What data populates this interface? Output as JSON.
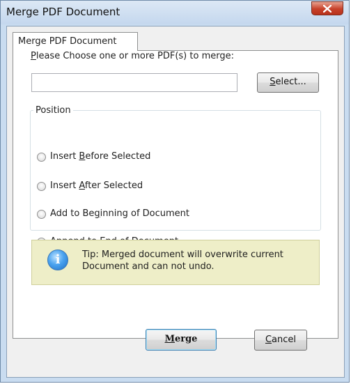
{
  "window": {
    "title": "Merge PDF Document"
  },
  "tab": {
    "label": "Merge PDF Document"
  },
  "instruction": {
    "prefix": "P",
    "rest": "lease Choose one or more PDF(s) to merge:"
  },
  "file_input": {
    "value": "",
    "placeholder": ""
  },
  "select_button": {
    "prefix": "S",
    "rest": "elect..."
  },
  "position_group": {
    "label": "Position",
    "options": [
      {
        "pre": "Insert ",
        "key": "B",
        "post": "efore Selected",
        "checked": false
      },
      {
        "pre": "Insert ",
        "key": "A",
        "post": "fter Selected",
        "checked": false
      },
      {
        "pre": "Add to Be",
        "key": "g",
        "post": "inning of Document",
        "checked": false
      },
      {
        "pre": "Append to ",
        "key": "E",
        "post": "nd of Document",
        "checked": true
      }
    ]
  },
  "tip": {
    "icon": "info-icon",
    "line1": "Tip: Merged document will overwrite current",
    "line2": "Document and can not undo."
  },
  "buttons": {
    "merge": {
      "key": "M",
      "rest": "erge"
    },
    "cancel": {
      "key": "C",
      "rest": "ancel"
    }
  },
  "colors": {
    "window_frame": "#c9dcf0",
    "close_button": "#c7412a",
    "tip_background": "#eeeec8",
    "radio_selected": "#2b6fc4"
  }
}
